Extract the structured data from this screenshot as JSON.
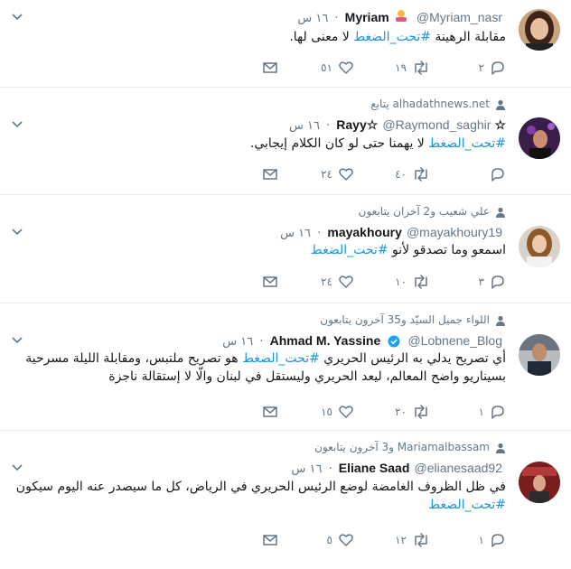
{
  "tweets": [
    {
      "context": "",
      "name": "Myriam",
      "handle": "@Myriam_nasr",
      "time": "١٦ س",
      "text_before": "مقابلة الرهينة ",
      "hashtag": "#تحت_الضغط",
      "text_after": " لا معنى لها.",
      "replies": "٢",
      "retweets": "١٩",
      "likes": "٥١"
    },
    {
      "context": "alhadathnews.net يتابع",
      "name": "☆Rayy☆",
      "handle": "@Raymond_saghir",
      "time": "١٦ س",
      "text_before": "",
      "hashtag": "#تحت_الضغط",
      "text_after": " لا يهمنا حتى لو كان الكلام إيجابي.",
      "replies": "",
      "retweets": "٤٠",
      "likes": "٢٤"
    },
    {
      "context": "علي شعيب و2 آخران يتابعون",
      "name": "mayakhoury",
      "handle": "@mayakhoury19",
      "time": "١٦ س",
      "text_before": "اسمعو وما تصدقو لأنو ",
      "hashtag": "#تحت_الضغط",
      "text_after": "",
      "replies": "٣",
      "retweets": "١٠",
      "likes": "٢٤"
    },
    {
      "context": "اللواء جميل السيّد و35 آخرون يتابعون",
      "name": "Ahmad M. Yassine",
      "handle": "@Lobnene_Blog",
      "time": "١٦ س",
      "text_before": "أي تصريح يدلي به الرئيس الحريري ",
      "hashtag": "#تحت_الضغط",
      "text_after": " هو تصريح ملتبس، ومقابلة الليلة مسرحية بسيناريو واضح المعالم، ليعد الحريري وليستقل في لبنان والّا لا إستقالة ناجزة",
      "replies": "١",
      "retweets": "٢٠",
      "likes": "١٥"
    },
    {
      "context": "Mariamalbassam و3 آخرون يتابعون",
      "name": "Eliane Saad",
      "handle": "@elianesaad92",
      "time": "١٦ س",
      "text_before": "في ظل الظروف الغامضة لوضع الرئيس الحريري في الرياض، كل ما سيصدر عنه اليوم سيكون ",
      "hashtag": "#تحت_الضغط",
      "text_after": "",
      "replies": "١",
      "retweets": "١٢",
      "likes": "٥"
    }
  ],
  "colors": {
    "hashtag": "#1b95e0",
    "secondary_text": "#657786",
    "primary_text": "#14171a",
    "divider": "#e6ecf0",
    "verified": "#1da1f2"
  },
  "icons": {
    "reply": "reply-icon",
    "retweet": "retweet-icon",
    "like": "heart-icon",
    "dm": "envelope-icon",
    "more": "chevron-down-icon",
    "context": "person-icon",
    "verified": "verified-badge-icon",
    "emoji": "person-shrugging-emoji"
  }
}
